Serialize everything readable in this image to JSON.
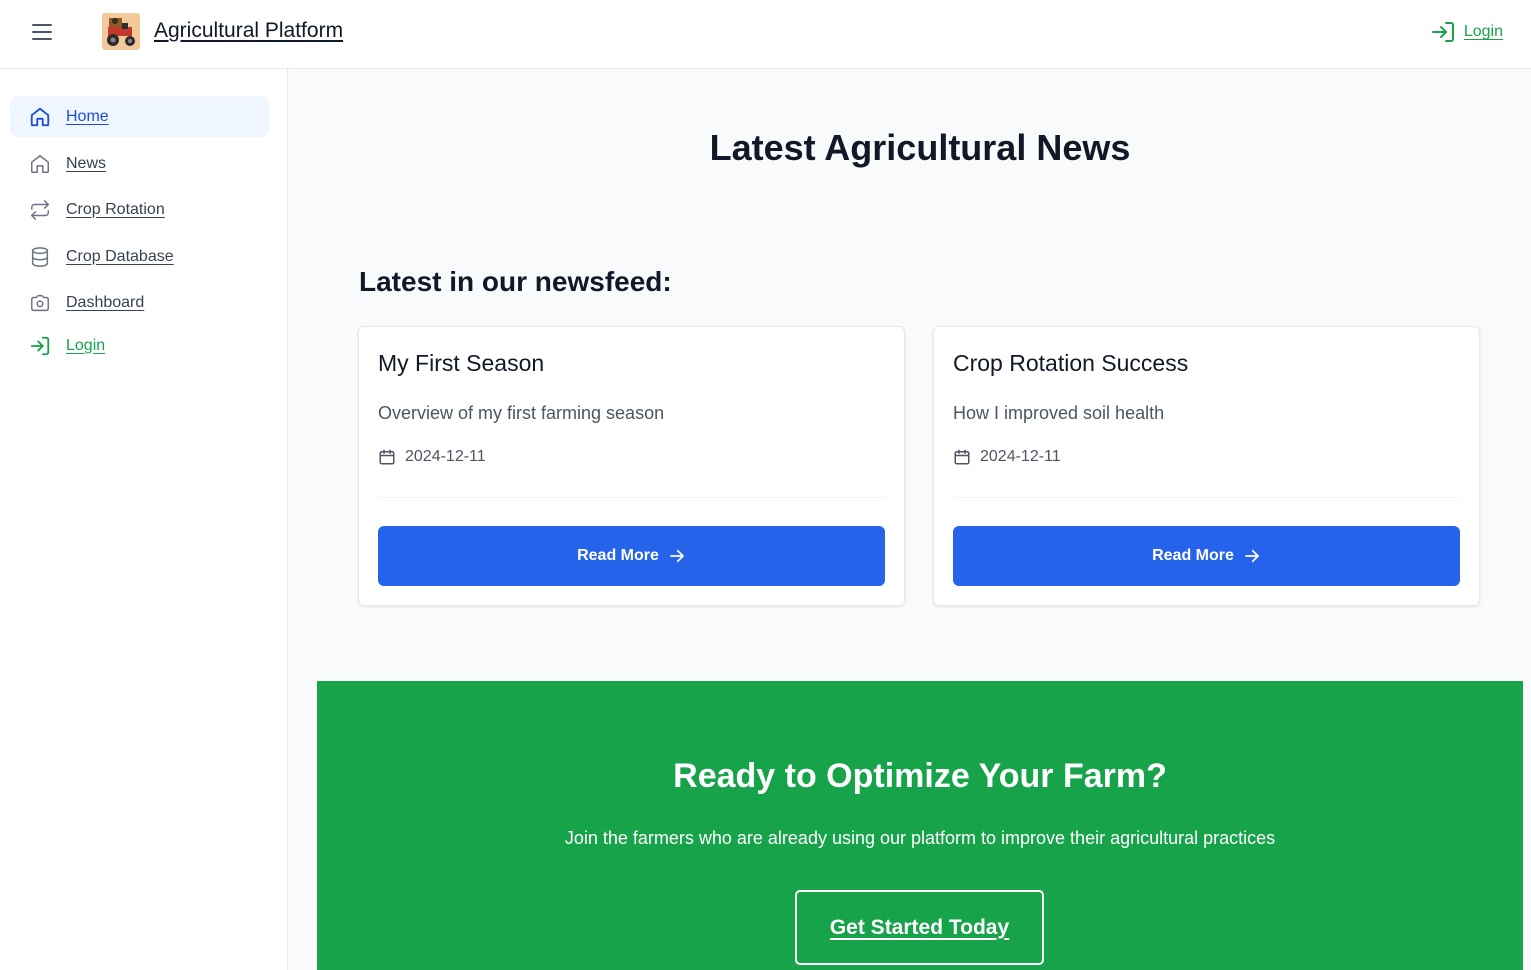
{
  "header": {
    "app_title": "Agricultural Platform",
    "login_label": "Login"
  },
  "sidebar": {
    "items": [
      {
        "label": "Home",
        "icon": "home-icon",
        "active": true
      },
      {
        "label": "News",
        "icon": "home-icon"
      },
      {
        "label": "Crop Rotation",
        "icon": "repeat-icon"
      },
      {
        "label": "Crop Database",
        "icon": "database-icon"
      },
      {
        "label": "Dashboard",
        "icon": "camera-icon"
      },
      {
        "label": "Login",
        "icon": "login-icon"
      }
    ]
  },
  "main": {
    "title": "Latest Agricultural News",
    "section_title": "Latest in our newsfeed:",
    "cards": [
      {
        "title": "My First Season",
        "description": "Overview of my first farming season",
        "date": "2024-12-11",
        "button_label": "Read More"
      },
      {
        "title": "Crop Rotation Success",
        "description": "How I improved soil health",
        "date": "2024-12-11",
        "button_label": "Read More"
      }
    ],
    "cta": {
      "title": "Ready to Optimize Your Farm?",
      "subtitle": "Join the farmers who are already using our platform to improve their agricultural practices",
      "button_label": "Get Started Today"
    }
  },
  "colors": {
    "primary_blue": "#2563eb",
    "accent_green": "#16a34a",
    "active_nav_bg": "#eff6ff"
  }
}
